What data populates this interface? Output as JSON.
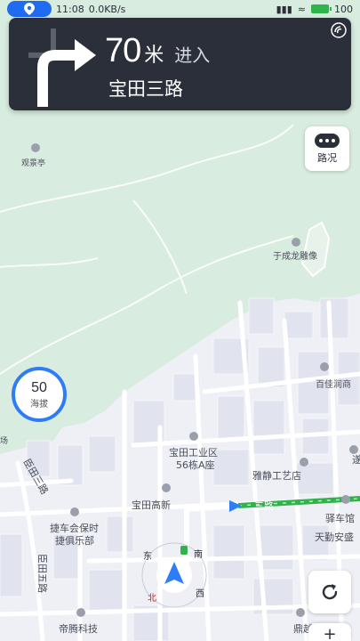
{
  "status_bar": {
    "time": "11:08",
    "speed": "0.0KB/s",
    "battery": "100"
  },
  "nav": {
    "distance": "70",
    "unit": "米",
    "action": "进入",
    "road": "宝田三路"
  },
  "buttons": {
    "traffic": "路况"
  },
  "altitude": {
    "value": "50",
    "unit": "海拔"
  },
  "map_labels": {
    "guanjingting": "观景亭",
    "yuchenglong": "于成龙雕像",
    "baitian_industrial": "宝田工业区",
    "building_56a": "56栋A座",
    "yajing": "雅静工艺店",
    "baitian_gaoxin": "宝田高新",
    "road_on_route": "三路",
    "baiyunrun": "百佳润商",
    "jieche": "捷车会保时",
    "jieche2": "捷俱乐部",
    "yizhan": "驿车馆",
    "tianqin": "天勤安盛",
    "chenitan3": "臣田三路",
    "chenitan5": "臣田五路",
    "diteng": "帝腾科技",
    "dingyue": "鼎越城",
    "compass_e": "东",
    "compass_s": "南",
    "compass_n": "北",
    "compass_w": "西",
    "sui": "遂",
    "yang": "场"
  },
  "colors": {
    "nav_bg": "#2b2f3a",
    "route": "#2fb34a",
    "accent": "#2f7df6",
    "park": "#d8ecdf"
  }
}
